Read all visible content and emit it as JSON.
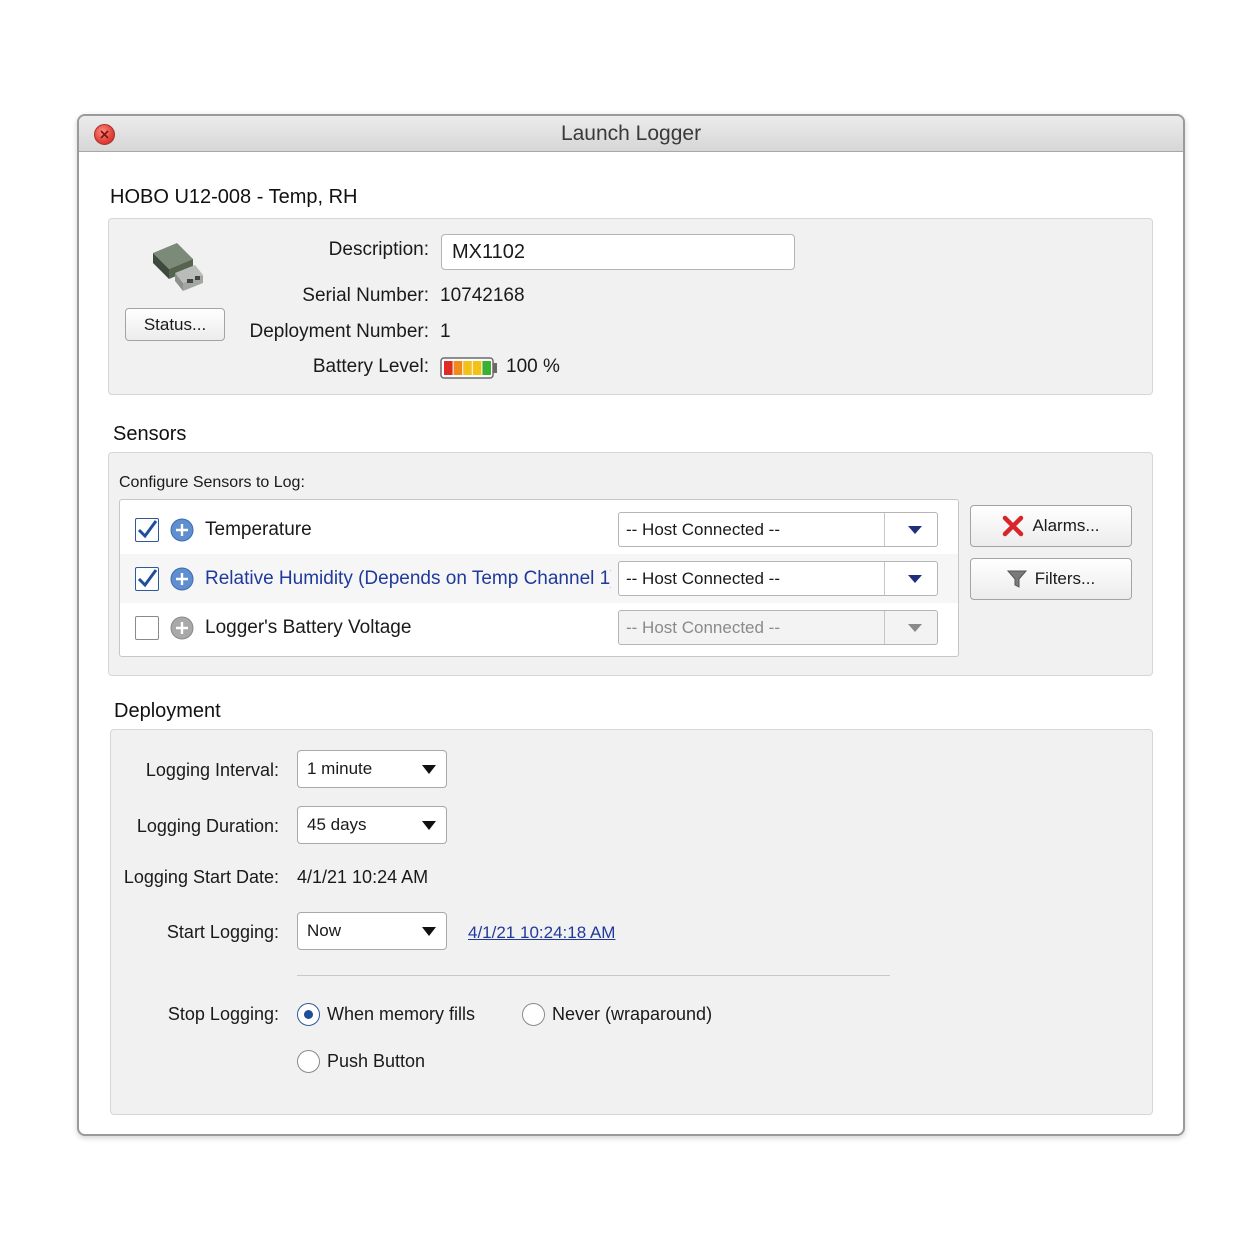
{
  "window": {
    "title": "Launch Logger"
  },
  "device": {
    "heading": "HOBO U12-008 - Temp, RH",
    "status_button": "Status...",
    "description_label": "Description:",
    "description_value": "MX1102",
    "serial_label": "Serial Number:",
    "serial_value": "10742168",
    "deployment_label": "Deployment Number:",
    "deployment_value": "1",
    "battery_label": "Battery Level:",
    "battery_value": "100 %",
    "battery_level": 1.0
  },
  "sensors": {
    "heading": "Sensors",
    "configure_label": "Configure Sensors to Log:",
    "alarms_button": "Alarms...",
    "filters_button": "Filters...",
    "items": [
      {
        "name": "Temperature",
        "checked": true,
        "channel": "-- Host Connected --",
        "enabled": true
      },
      {
        "name": "Relative Humidity (Depends on Temp Channel 1)",
        "checked": true,
        "channel": "-- Host Connected --",
        "enabled": true
      },
      {
        "name": "Logger's Battery Voltage",
        "checked": false,
        "channel": "-- Host Connected --",
        "enabled": false
      }
    ]
  },
  "deployment": {
    "heading": "Deployment",
    "interval_label": "Logging Interval:",
    "interval_value": "1 minute",
    "duration_label": "Logging Duration:",
    "duration_value": "45 days",
    "start_date_label": "Logging Start Date:",
    "start_date_value": "4/1/21 10:24 AM",
    "start_logging_label": "Start Logging:",
    "start_logging_value": "Now",
    "start_logging_time": "4/1/21 10:24:18 AM",
    "stop_logging_label": "Stop Logging:",
    "stop_options": [
      {
        "label": "When memory fills",
        "selected": true
      },
      {
        "label": "Never (wraparound)",
        "selected": false
      },
      {
        "label": "Push Button",
        "selected": false
      }
    ]
  },
  "colors": {
    "link": "#1f3a9c",
    "checkbox_check": "#1f4f9a",
    "alarm_icon": "#d9242b"
  }
}
